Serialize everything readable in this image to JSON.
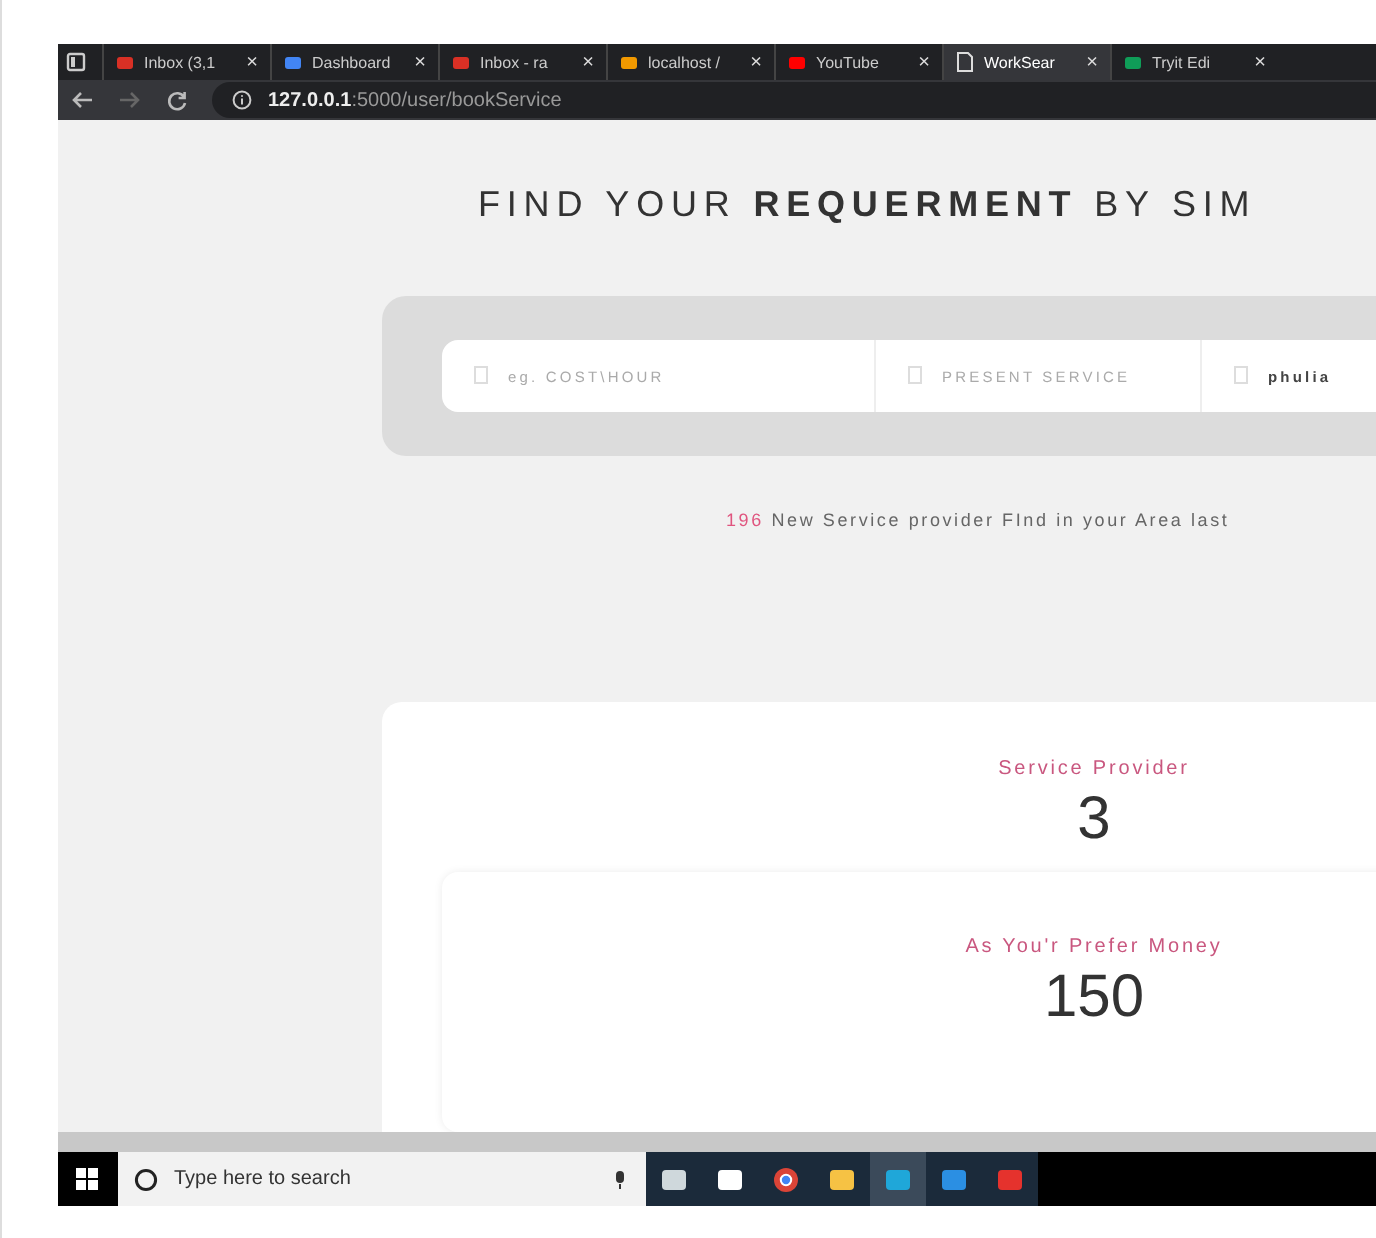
{
  "browser": {
    "tabs": [
      {
        "label": "Inbox (3,1",
        "selected": false
      },
      {
        "label": "Dashboard",
        "selected": false
      },
      {
        "label": "Inbox - ra",
        "selected": false
      },
      {
        "label": "localhost /",
        "selected": false
      },
      {
        "label": "YouTube",
        "selected": false
      },
      {
        "label": "WorkSear",
        "selected": true
      },
      {
        "label": "Tryit Edi",
        "selected": false
      }
    ],
    "close_glyph": "×",
    "url": {
      "host": "127.0.0.1",
      "path": ":5000/user/bookService"
    }
  },
  "page": {
    "heading": "FIND YOUR **REQUERMENT** BY SIM",
    "search_fields": [
      {
        "placeholder": "eg. COST\\HOUR"
      },
      {
        "placeholder": "PRESENT SERVICE"
      },
      {
        "value": "phulia"
      }
    ],
    "notice": {
      "count": "196",
      "text": "New Service provider FInd in your Area last"
    },
    "stats": [
      {
        "label": "Service Provider",
        "value": "3"
      },
      {
        "label": "As You'r Prefer Money",
        "value": "150"
      }
    ]
  },
  "taskbar": {
    "search": {
      "placeholder": "Type here to search"
    },
    "apps": [
      {
        "selected": false
      },
      {
        "selected": false
      },
      {
        "selected": false
      },
      {
        "selected": false
      },
      {
        "selected": true
      },
      {
        "selected": false
      },
      {
        "selected": false
      }
    ]
  }
}
